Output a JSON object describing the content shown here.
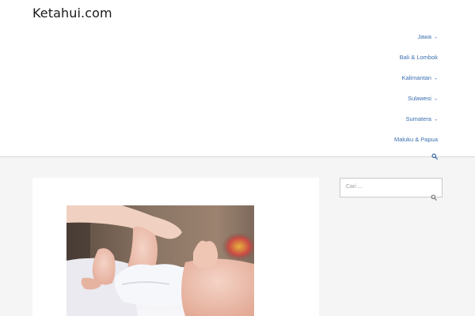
{
  "site": {
    "title": "Ketahui.com"
  },
  "nav": {
    "items": [
      {
        "label": "Jawa",
        "has_dropdown": true
      },
      {
        "label": "Bali & Lombok",
        "has_dropdown": false
      },
      {
        "label": "Kalimantan",
        "has_dropdown": true
      },
      {
        "label": "Sulawesi",
        "has_dropdown": true
      },
      {
        "label": "Sumatera",
        "has_dropdown": true
      },
      {
        "label": "Maluku & Papua",
        "has_dropdown": false
      }
    ],
    "search_icon": "search-icon"
  },
  "sidebar": {
    "search": {
      "placeholder": "Cari ...",
      "icon": "search-icon"
    }
  },
  "colors": {
    "nav_link": "#3a6fb0",
    "header_bg": "#ffffff",
    "page_bg": "#f5f5f5"
  }
}
